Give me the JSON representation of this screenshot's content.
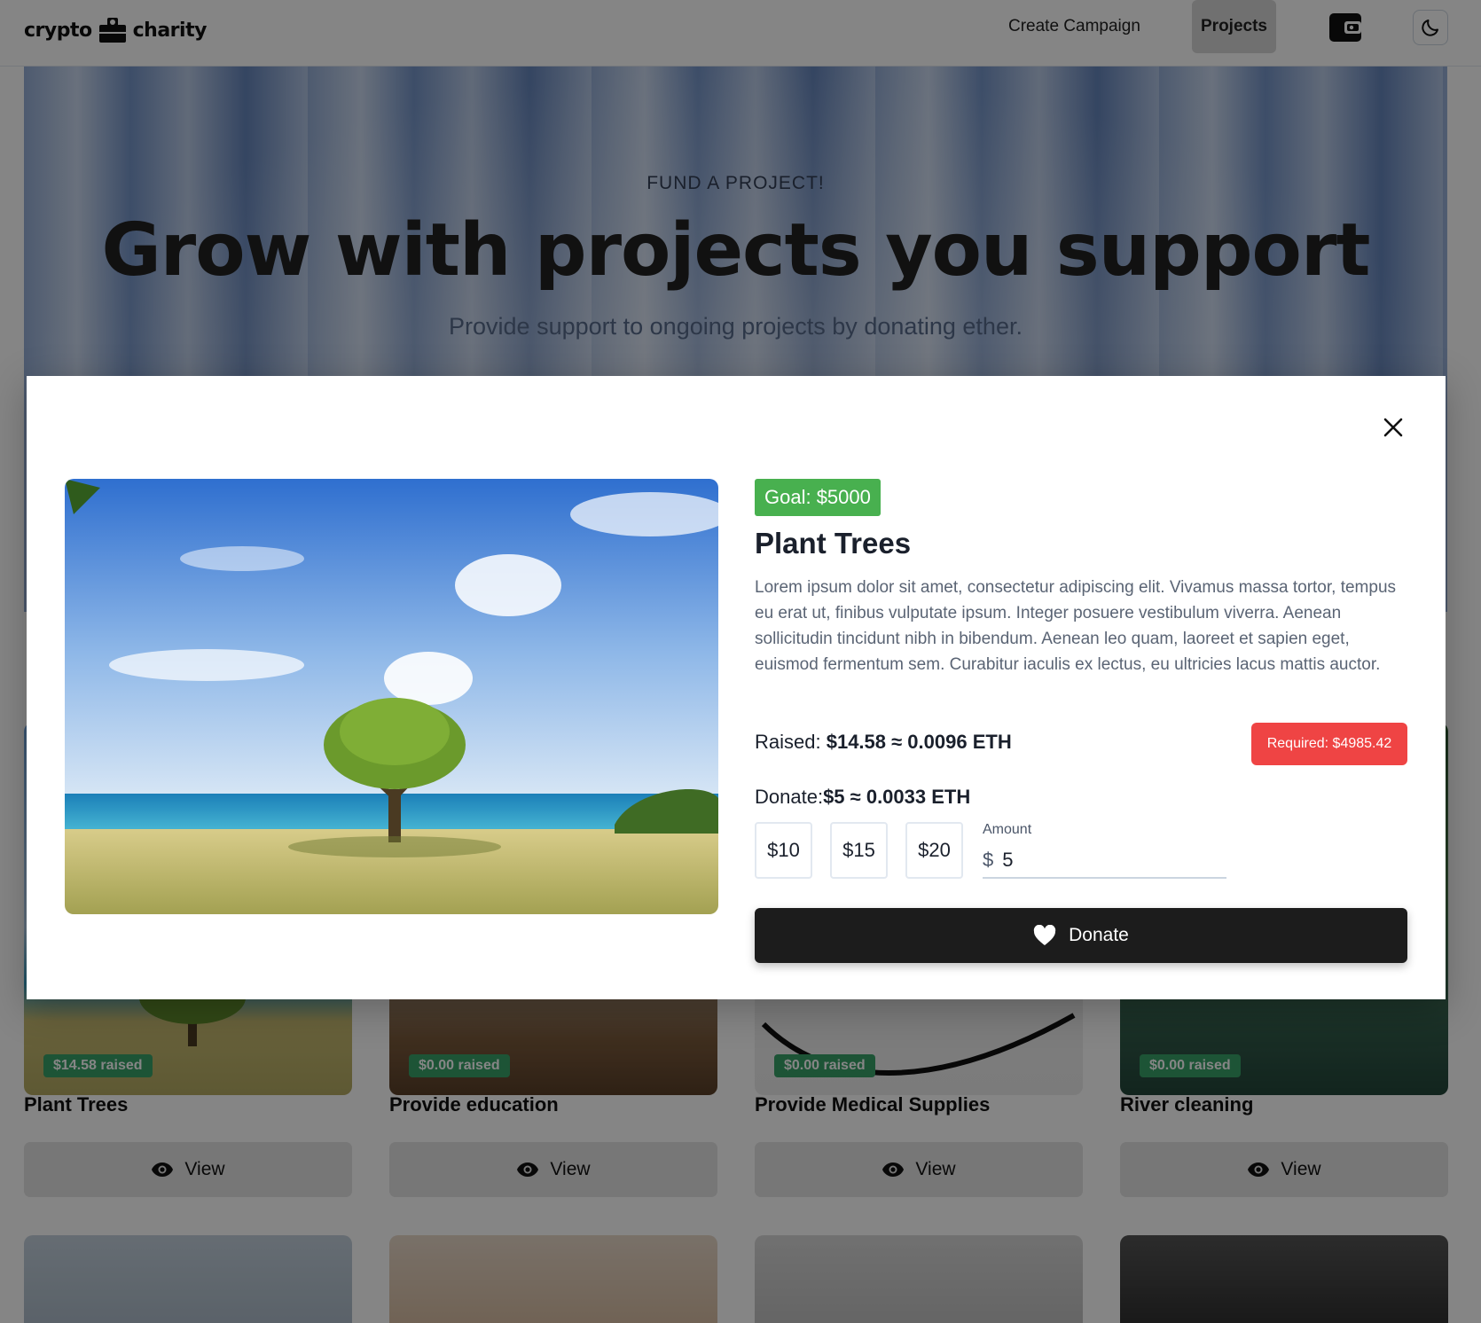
{
  "navbar": {
    "logo_left": "crypto",
    "logo_right": "charity",
    "create_campaign": "Create Campaign",
    "projects": "Projects"
  },
  "hero": {
    "eyebrow": "FUND A PROJECT!",
    "title": "Grow with projects you support",
    "subtitle": "Provide support to ongoing projects by donating ether."
  },
  "cards": [
    {
      "title": "Plant Trees",
      "raised": "$14.58 raised",
      "view": "View"
    },
    {
      "title": "Provide education",
      "raised": "$0.00 raised",
      "view": "View"
    },
    {
      "title": "Provide Medical Supplies",
      "raised": "$0.00 raised",
      "view": "View"
    },
    {
      "title": "River cleaning",
      "raised": "$0.00 raised",
      "view": "View"
    }
  ],
  "modal": {
    "goal": "Goal: $5000",
    "title": "Plant Trees",
    "description": "Lorem ipsum dolor sit amet, consectetur adipiscing elit. Vivamus massa tortor, tempus eu erat ut, finibus vulputate ipsum. Integer posuere vestibulum viverra. Aenean sollicitudin tincidunt nibh in bibendum. Aenean leo quam, laoreet et sapien eget, euismod fermentum sem. Curabitur iaculis ex lectus, eu ultricies lacus mattis auctor.",
    "raised_label": "Raised:",
    "raised_value": "$14.58 ≈ 0.0096 ETH",
    "required": "Required: $4985.42",
    "donate_label": "Donate:",
    "donate_value": "$5 ≈ 0.0033 ETH",
    "amount_buttons": [
      "$10",
      "$15",
      "$20"
    ],
    "amount_label": "Amount",
    "currency_symbol": "$",
    "amount_value": "5",
    "donate_button": "Donate"
  },
  "colors": {
    "goal_badge": "#48b04f",
    "required_badge": "#ef4444",
    "raised_badge": "#38a169",
    "donate_button": "#1c1c1c"
  },
  "icons": [
    "wallet-icon",
    "moon-icon",
    "close-icon",
    "heart-icon",
    "eye-icon"
  ]
}
